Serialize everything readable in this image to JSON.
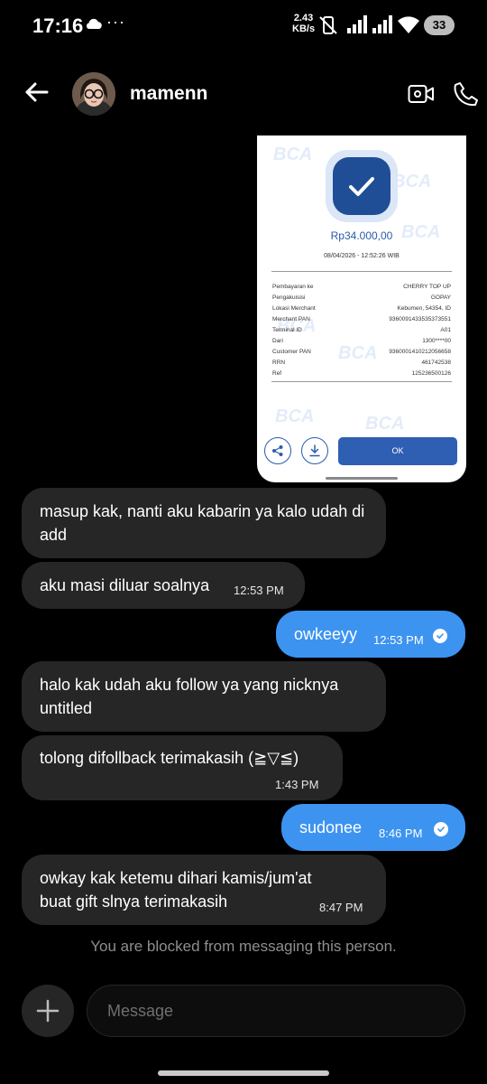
{
  "status_bar": {
    "time": "17:16",
    "more": "···",
    "net_speed_value": "2.43",
    "net_speed_unit": "KB/s",
    "battery": "33"
  },
  "header": {
    "contact_name": "mamenn"
  },
  "receipt": {
    "amount": "Rp34.000,00",
    "datetime": "08/04/2026 - 12:52:26 WIB",
    "rows": [
      {
        "label": "Pembayaran ke",
        "value": "CHERRY TOP UP"
      },
      {
        "label": "Pengakuisisi",
        "value": "GOPAY"
      },
      {
        "label": "Lokasi Merchant",
        "value": "Kebumen, 54354, ID"
      },
      {
        "label": "Merchant PAN",
        "value": "9360091433535373551"
      },
      {
        "label": "Terminal ID",
        "value": "A01"
      },
      {
        "label": "Dari",
        "value": "1300****00"
      },
      {
        "label": "Customer PAN",
        "value": "9360001410212056658"
      },
      {
        "label": "RRN",
        "value": "461742538"
      },
      {
        "label": "Ref",
        "value": "125236500126"
      }
    ],
    "ok_label": "OK",
    "watermark": "BCA"
  },
  "messages": [
    {
      "id": "m1",
      "direction": "in",
      "text": "masup kak, nanti aku kabarin ya kalo udah di add",
      "time": ""
    },
    {
      "id": "m2",
      "direction": "in",
      "text": "aku masi diluar soalnya",
      "time": "12:53 PM"
    },
    {
      "id": "m3",
      "direction": "out",
      "text": "owkeeyy",
      "time": "12:53 PM"
    },
    {
      "id": "m4",
      "direction": "in",
      "text": "halo kak udah aku follow ya yang nicknya untitled",
      "time": ""
    },
    {
      "id": "m5",
      "direction": "in",
      "text": "tolong difollback terimakasih (≧▽≦)",
      "time": "1:43 PM"
    },
    {
      "id": "m6",
      "direction": "out",
      "text": "sudonee",
      "time": "8:46 PM"
    },
    {
      "id": "m7",
      "direction": "in",
      "text": "owkay kak ketemu dihari kamis/jum'at buat gift slnya terimakasih",
      "time": "8:47 PM"
    }
  ],
  "blocked_notice": "You are blocked from messaging this person.",
  "composer": {
    "placeholder": "Message"
  },
  "colors": {
    "outgoing_bubble": "#3d93f0",
    "incoming_bubble": "#262626",
    "background": "#000000"
  }
}
